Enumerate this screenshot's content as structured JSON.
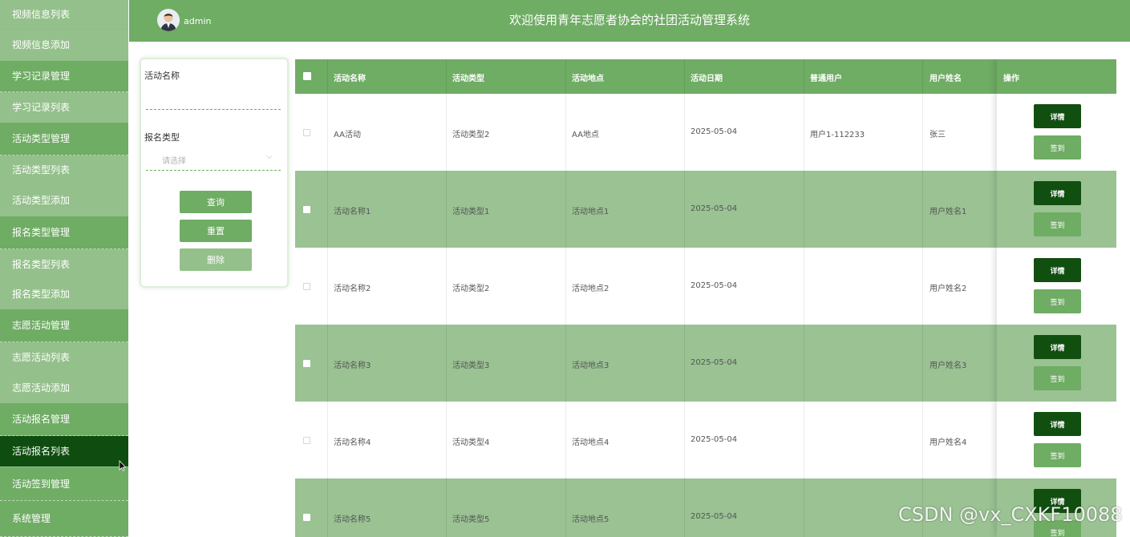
{
  "sidebar": {
    "items": [
      {
        "label": "视频信息列表",
        "kind": "sub"
      },
      {
        "label": "视频信息添加",
        "kind": "sub"
      },
      {
        "label": "学习记录管理",
        "kind": "group"
      },
      {
        "label": "学习记录列表",
        "kind": "sub"
      },
      {
        "label": "活动类型管理",
        "kind": "group"
      },
      {
        "label": "活动类型列表",
        "kind": "sub"
      },
      {
        "label": "活动类型添加",
        "kind": "sub"
      },
      {
        "label": "报名类型管理",
        "kind": "group"
      },
      {
        "label": "报名类型列表",
        "kind": "sub"
      },
      {
        "label": "报名类型添加",
        "kind": "sub"
      },
      {
        "label": "志愿活动管理",
        "kind": "group"
      },
      {
        "label": "志愿活动列表",
        "kind": "sub"
      },
      {
        "label": "志愿活动添加",
        "kind": "sub"
      },
      {
        "label": "活动报名管理",
        "kind": "group"
      },
      {
        "label": "活动报名列表",
        "kind": "active"
      },
      {
        "label": "活动签到管理",
        "kind": "group"
      },
      {
        "label": "系统管理",
        "kind": "group"
      }
    ]
  },
  "header": {
    "username": "admin",
    "title": "欢迎使用青年志愿者协会的社团活动管理系统"
  },
  "search": {
    "name_label": "活动名称",
    "name_value": "",
    "type_label": "报名类型",
    "type_placeholder": "请选择",
    "query_label": "查询",
    "reset_label": "重置",
    "delete_label": "删除"
  },
  "table": {
    "headers": [
      "活动名称",
      "活动类型",
      "活动地点",
      "活动日期",
      "普通用户",
      "用户姓名",
      "操作"
    ],
    "detail_label": "详情",
    "sign_label": "签到",
    "rows": [
      [
        "AA活动",
        "活动类型2",
        "AA地点",
        "2025-05-04",
        "用户1-112233",
        "张三"
      ],
      [
        "活动名称1",
        "活动类型1",
        "活动地点1",
        "2025-05-04",
        "",
        "用户姓名1"
      ],
      [
        "活动名称2",
        "活动类型2",
        "活动地点2",
        "2025-05-04",
        "",
        "用户姓名2"
      ],
      [
        "活动名称3",
        "活动类型3",
        "活动地点3",
        "2025-05-04",
        "",
        "用户姓名3"
      ],
      [
        "活动名称4",
        "活动类型4",
        "活动地点4",
        "2025-05-04",
        "",
        "用户姓名4"
      ],
      [
        "活动名称5",
        "活动类型5",
        "活动地点5",
        "2025-05-04",
        "",
        ""
      ]
    ]
  },
  "watermark": "CSDN @vx_CXKF10088",
  "colors": {
    "primary": "#6fac64",
    "light": "#94c08b",
    "dark": "#114f10",
    "active": "#0e4d0f"
  }
}
